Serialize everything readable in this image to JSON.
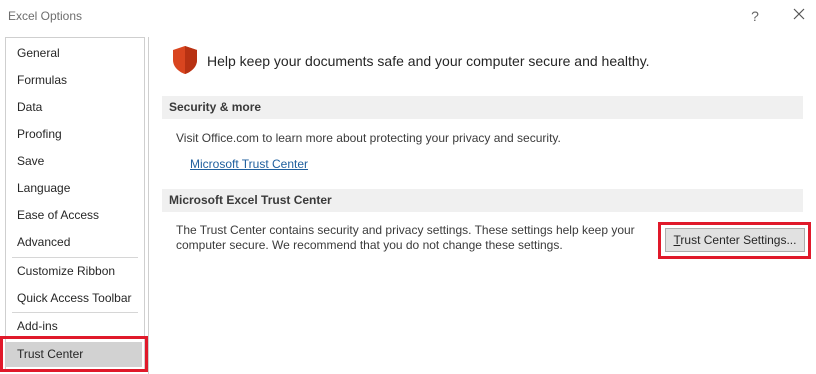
{
  "window": {
    "title": "Excel Options",
    "help_label": "?"
  },
  "sidebar": {
    "items": [
      {
        "label": "General"
      },
      {
        "label": "Formulas"
      },
      {
        "label": "Data"
      },
      {
        "label": "Proofing"
      },
      {
        "label": "Save"
      },
      {
        "label": "Language"
      },
      {
        "label": "Ease of Access"
      },
      {
        "label": "Advanced"
      },
      {
        "label": "Customize Ribbon"
      },
      {
        "label": "Quick Access Toolbar"
      },
      {
        "label": "Add-ins"
      },
      {
        "label": "Trust Center",
        "selected": true
      }
    ]
  },
  "main": {
    "headline": "Help keep your documents safe and your computer secure and healthy.",
    "security": {
      "header": "Security & more",
      "text": "Visit Office.com to learn more about protecting your privacy and security.",
      "link": "Microsoft Trust Center"
    },
    "trust_center": {
      "header": "Microsoft Excel Trust Center",
      "text_line1": "The Trust Center contains security and privacy settings. These settings help keep your",
      "text_line2": "computer secure. We recommend that you do not change these settings.",
      "button_rest": "rust Center Settings...",
      "button_mnemonic": "T"
    }
  },
  "colors": {
    "highlight": "#e0192a",
    "shield": "#d9451f",
    "link": "#1f5f9e",
    "section_bg": "#f0f0f0",
    "selected_bg": "#d2d2d2"
  }
}
